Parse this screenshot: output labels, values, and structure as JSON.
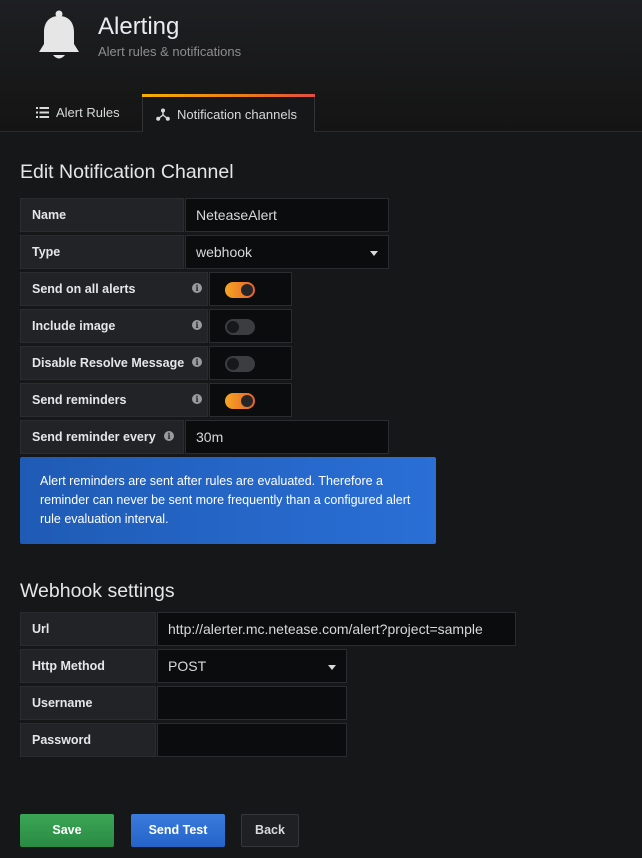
{
  "header": {
    "title": "Alerting",
    "subtitle": "Alert rules & notifications",
    "icon": "bell-icon"
  },
  "tabs": [
    {
      "label": "Alert Rules",
      "icon": "list-icon",
      "active": false
    },
    {
      "label": "Notification channels",
      "icon": "share-nodes-icon",
      "active": true
    }
  ],
  "edit": {
    "title": "Edit Notification Channel",
    "name_label": "Name",
    "name_value": "NeteaseAlert",
    "type_label": "Type",
    "type_value": "webhook",
    "send_all_label": "Send on all alerts",
    "send_all_on": true,
    "include_image_label": "Include image",
    "include_image_on": false,
    "disable_resolve_label": "Disable Resolve Message",
    "disable_resolve_on": false,
    "send_reminders_label": "Send reminders",
    "send_reminders_on": true,
    "reminder_every_label": "Send reminder every",
    "reminder_every_value": "30m",
    "info_text": "Alert reminders are sent after rules are evaluated. Therefore a reminder can never be sent more frequently than a configured alert rule evaluation interval."
  },
  "webhook": {
    "title": "Webhook settings",
    "url_label": "Url",
    "url_value": "http://alerter.mc.netease.com/alert?project=sample",
    "method_label": "Http Method",
    "method_value": "POST",
    "username_label": "Username",
    "username_value": "",
    "password_label": "Password",
    "password_value": ""
  },
  "buttons": {
    "save": "Save",
    "send_test": "Send Test",
    "back": "Back"
  },
  "colors": {
    "background": "#161719",
    "toggle_on": "#eb7b18",
    "save_button": "#2f9b4c",
    "test_button": "#2f6fd2",
    "info_box": "#2566cc"
  }
}
